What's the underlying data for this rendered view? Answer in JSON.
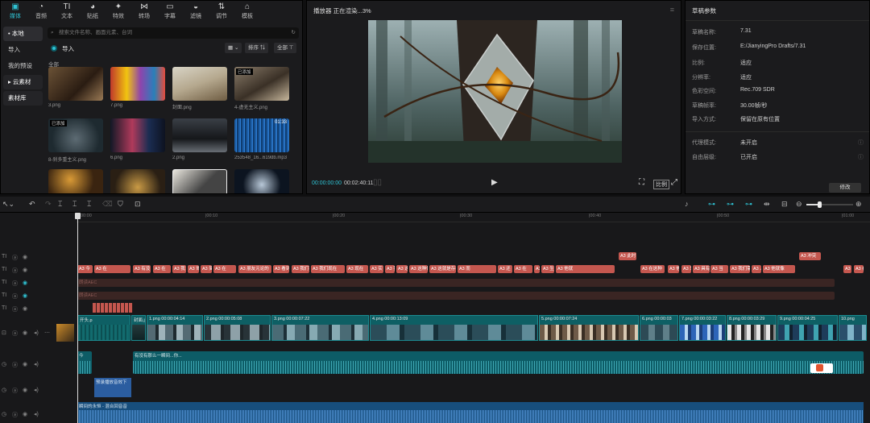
{
  "tools": [
    {
      "label": "媒体",
      "icon": "media-icon",
      "glyph": "▣"
    },
    {
      "label": "音频",
      "icon": "audio-icon",
      "glyph": "◔"
    },
    {
      "label": "文本",
      "icon": "text-icon",
      "glyph": "TI"
    },
    {
      "label": "贴纸",
      "icon": "sticker-icon",
      "glyph": "◕"
    },
    {
      "label": "特效",
      "icon": "effects-icon",
      "glyph": "✦"
    },
    {
      "label": "转场",
      "icon": "transition-icon",
      "glyph": "⋈"
    },
    {
      "label": "字幕",
      "icon": "subtitle-icon",
      "glyph": "▭"
    },
    {
      "label": "滤镜",
      "icon": "filter-icon",
      "glyph": "◒"
    },
    {
      "label": "调节",
      "icon": "adjust-icon",
      "glyph": "⇅"
    },
    {
      "label": "模板",
      "icon": "template-icon",
      "glyph": "⌂"
    }
  ],
  "left_nav": [
    {
      "label": "• 本地"
    },
    {
      "label": "导入"
    },
    {
      "label": "我的预设"
    },
    {
      "label": "▸ 云素材"
    },
    {
      "label": "素材库"
    }
  ],
  "search": {
    "placeholder": "搜索文件名称、画面元素、台词"
  },
  "media": {
    "import_label": "导入",
    "sort_label": "排序 ⇅",
    "all_filter": "全部 ⊤",
    "section": "全部",
    "added_tag": "已添加",
    "items": [
      {
        "name": "3.png"
      },
      {
        "name": "7.png"
      },
      {
        "name": "封面.png"
      },
      {
        "name": "4-虚无主义.png"
      },
      {
        "name": "8-刹多重主义.png"
      },
      {
        "name": "6.png"
      },
      {
        "name": "2.png"
      },
      {
        "name": "253548_16...619db.mp3",
        "duration": "01:33"
      }
    ]
  },
  "player": {
    "title": "播放器 正在渲染...3%",
    "time_current": "00:00:00:00",
    "time_total": "00:02:40:11",
    "ratio": "比例"
  },
  "params": {
    "title": "草稿参数",
    "rows": [
      {
        "label": "草稿名称:",
        "value": "7.31"
      },
      {
        "label": "保存位置:",
        "value": "E:/JianyingPro Drafts/7.31"
      },
      {
        "label": "比例:",
        "value": "适应"
      },
      {
        "label": "分辨率:",
        "value": "适应"
      },
      {
        "label": "色彩空间:",
        "value": "Rec.709 SDR"
      },
      {
        "label": "草稿帧率:",
        "value": "30.00帧/秒"
      },
      {
        "label": "导入方式:",
        "value": "保留在原有位置"
      }
    ],
    "rows2": [
      {
        "label": "代理模式:",
        "value": "未开启"
      },
      {
        "label": "自由层级:",
        "value": "已开启"
      }
    ],
    "edit_label": "修改"
  },
  "timeline": {
    "ruler": [
      "00:00",
      "|00:10",
      "|00:20",
      "|00:30",
      "|00:40",
      "|00:50",
      "|01:00"
    ],
    "text_segs_top": [
      {
        "label": "A3 此时"
      },
      {
        "label": "A3 冲突"
      }
    ],
    "text_segs": [
      {
        "label": "A3 今"
      },
      {
        "label": "A3 在"
      },
      {
        "label": "A3 有没"
      },
      {
        "label": "A3 在"
      },
      {
        "label": "A3 我"
      },
      {
        "label": "A3 哥"
      },
      {
        "label": "A3 简单的一"
      },
      {
        "label": "A3 在"
      },
      {
        "label": "A3 朋友元论的"
      },
      {
        "label": "A3 看到"
      },
      {
        "label": "A3 我们不可"
      },
      {
        "label": "A3 我们现在"
      },
      {
        "label": "A3 现在"
      },
      {
        "label": "A3 实"
      },
      {
        "label": "A3 我们到了"
      },
      {
        "label": "A3 这是"
      },
      {
        "label": "A3 这种做"
      },
      {
        "label": "A3 这就是存在主义"
      },
      {
        "label": "A3 而"
      },
      {
        "label": "A3 还"
      },
      {
        "label": "A3 在"
      },
      {
        "label": "A3 在刚"
      },
      {
        "label": "A3 生而在20世纪"
      },
      {
        "label": "A3 他就"
      },
      {
        "label": "A3 在这种"
      },
      {
        "label": "A3 他"
      },
      {
        "label": "A3 来"
      },
      {
        "label": "A3 具有"
      },
      {
        "label": "A3 当"
      },
      {
        "label": "A3 我们需要"
      },
      {
        "label": "A3 人"
      },
      {
        "label": "A3 他就像"
      },
      {
        "label": "A3 但"
      },
      {
        "label": "A3 在"
      }
    ],
    "dark_track1": "朗读AEC",
    "dark_track2": "朗读AEC",
    "video_clips": [
      {
        "label": "开头.p"
      },
      {
        "label": "封面.j"
      },
      {
        "label": "1.png 00:00:04:14"
      },
      {
        "label": "2.png 00:00:05:08"
      },
      {
        "label": "3.png 00:00:07:22"
      },
      {
        "label": "4.png 00:00:13:09"
      },
      {
        "label": "5.png 00:00:07:24"
      },
      {
        "label": "6.png 00:00:03"
      },
      {
        "label": "7.png 00:00:03:22"
      },
      {
        "label": "8.png 00:00:03:29"
      },
      {
        "label": "9.png 00:00:04:25"
      },
      {
        "label": "10.png"
      }
    ],
    "audio1a": "今",
    "audio1b": "有没有那么一瞬间...你...",
    "audio2": "预录播放音效下",
    "audio3": "瞬间的永恒 - 混合回音音"
  }
}
